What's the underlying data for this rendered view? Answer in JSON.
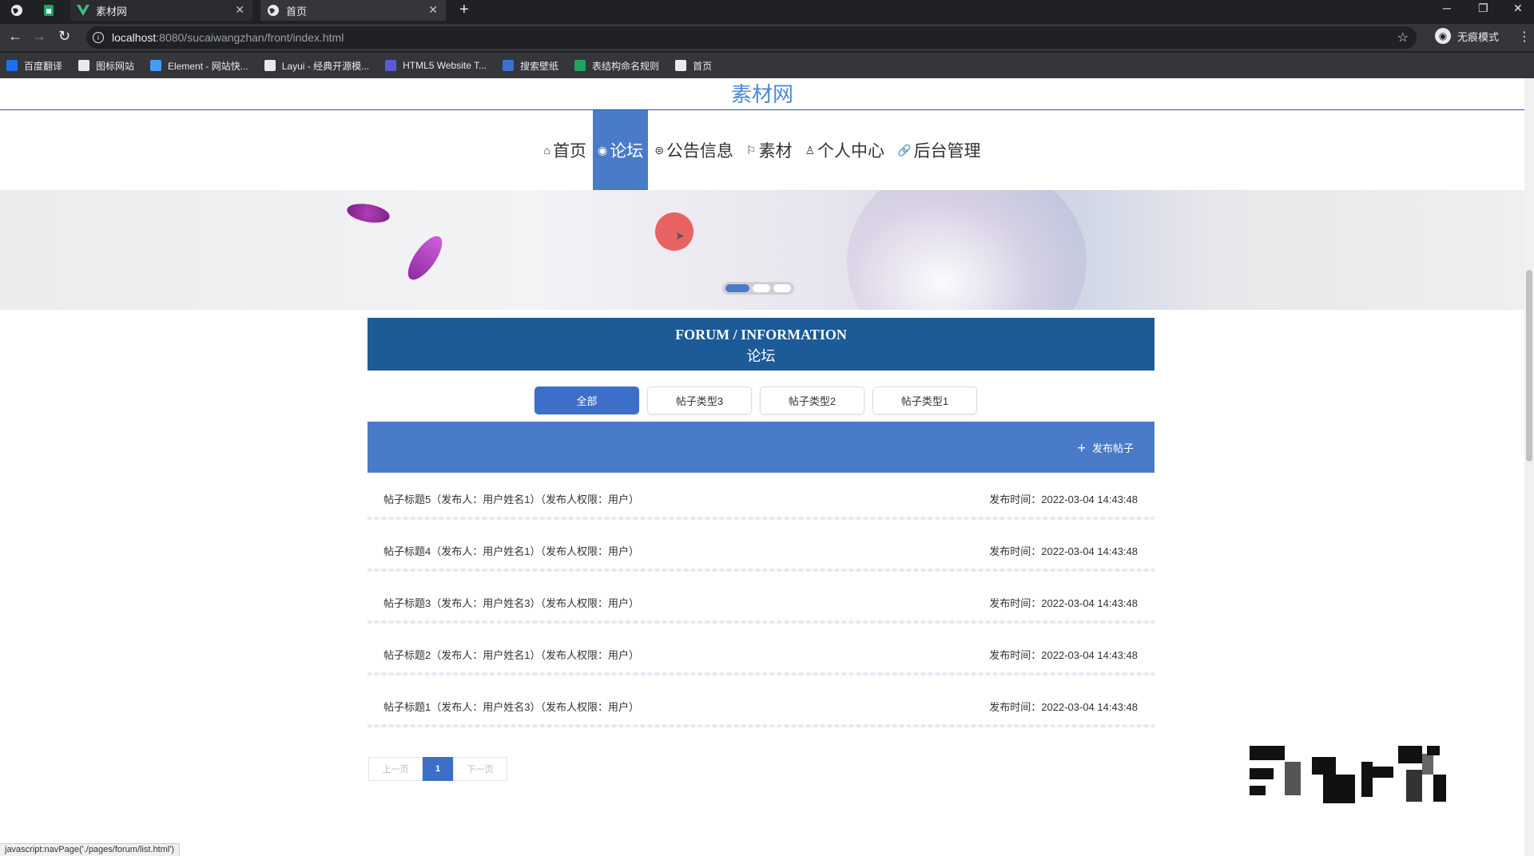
{
  "browser": {
    "tabs": [
      {
        "title": "素材网",
        "icon": "vue-icon"
      },
      {
        "title": "首页",
        "icon": "globe-icon"
      }
    ],
    "url_host": "localhost",
    "url_path": ":8080/sucaiwangzhan/front/index.html",
    "profile_label": "无痕模式",
    "bookmarks": [
      {
        "label": "百度翻译",
        "icon": "translate-icon",
        "color": "#1e6ff5"
      },
      {
        "label": "图标网站",
        "icon": "flag-icon",
        "color": "#e8eaed"
      },
      {
        "label": "Element - 网站快...",
        "icon": "element-icon",
        "color": "#409eff"
      },
      {
        "label": "Layui - 经典开源模...",
        "icon": "layui-icon",
        "color": "#e8eaed"
      },
      {
        "label": "HTML5 Website T...",
        "icon": "html5-icon",
        "color": "#5a5ad8"
      },
      {
        "label": "搜索壁纸",
        "icon": "wallpaper-icon",
        "color": "#3b6fd4"
      },
      {
        "label": "表结构命名规则",
        "icon": "sheet-icon",
        "color": "#1fa463"
      },
      {
        "label": "首页",
        "icon": "globe-icon",
        "color": "#e8eaed"
      }
    ]
  },
  "site": {
    "title": "素材网",
    "nav": [
      {
        "label": "首页",
        "icon": "⌂",
        "active": false
      },
      {
        "label": "论坛",
        "icon": "◉",
        "active": true
      },
      {
        "label": "公告信息",
        "icon": "⊜",
        "active": false
      },
      {
        "label": "素材",
        "icon": "⚐",
        "active": false
      },
      {
        "label": "个人中心",
        "icon": "♙",
        "active": false
      },
      {
        "label": "后台管理",
        "icon": "🔗",
        "active": false
      }
    ],
    "accent": "#4a7bc8",
    "header_color": "#1c5a98"
  },
  "section": {
    "title_en": "FORUM / INFORMATION",
    "title_cn": "论坛"
  },
  "filters": [
    {
      "label": "全部",
      "active": true
    },
    {
      "label": "帖子类型3",
      "active": false
    },
    {
      "label": "帖子类型2",
      "active": false
    },
    {
      "label": "帖子类型1",
      "active": false
    }
  ],
  "post_button": "发布帖子",
  "posts": [
    {
      "title": "帖子标题5（发布人：用户姓名1）（发布人权限：用户）",
      "time": "发布时间：2022-03-04 14:43:48"
    },
    {
      "title": "帖子标题4（发布人：用户姓名1）（发布人权限：用户）",
      "time": "发布时间：2022-03-04 14:43:48"
    },
    {
      "title": "帖子标题3（发布人：用户姓名3）（发布人权限：用户）",
      "time": "发布时间：2022-03-04 14:43:48"
    },
    {
      "title": "帖子标题2（发布人：用户姓名1）（发布人权限：用户）",
      "time": "发布时间：2022-03-04 14:43:48"
    },
    {
      "title": "帖子标题1（发布人：用户姓名3）（发布人权限：用户）",
      "time": "发布时间：2022-03-04 14:43:48"
    }
  ],
  "pager": {
    "prev": "上一页",
    "current": "1",
    "next": "下一页"
  },
  "status_url": "javascript:navPage('./pages/forum/list.html')"
}
